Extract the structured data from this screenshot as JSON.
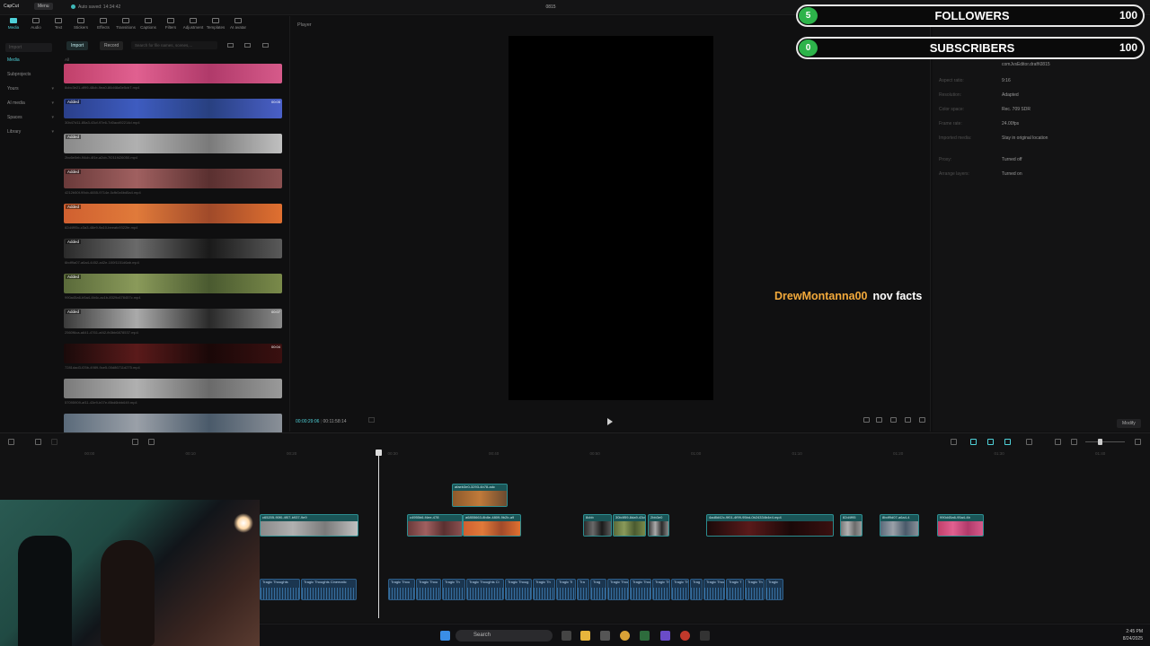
{
  "titlebar": {
    "logo": "CapCut",
    "menu": "Menu",
    "autosave": "Auto saved: 14:34:42",
    "project": "0815"
  },
  "tools": [
    "Media",
    "Audio",
    "Text",
    "Stickers",
    "Effects",
    "Transitions",
    "Captions",
    "Filters",
    "Adjustment",
    "Templates",
    "AI avatar"
  ],
  "leftnav": {
    "header": "Import",
    "items": [
      "Media",
      "Subprojects",
      "Yours",
      "AI media",
      "Spaces",
      "Library"
    ]
  },
  "media": {
    "import": "Import",
    "record": "Record",
    "search_placeholder": "Search for file names, scenes,...",
    "all_label": "All",
    "clips": [
      {
        "badge": "",
        "dur": "",
        "label": "8cbc3e21-df99-48cb-9ea0-86d48a5e5cb7.mp4"
      },
      {
        "badge": "Added",
        "dur": "00:05",
        "label": "30b47d11-85a3-43cf-97e6-7d0acd92214d.mp4"
      },
      {
        "badge": "Added",
        "dur": "",
        "label": "2bc6e0eb-94cb-4f1e-a2cb-7f211f426050.mp4"
      },
      {
        "badge": "Added",
        "dur": "",
        "label": "4212b50f-99cb-4655-9714e-0cfb0c6bd5a4.mp4"
      },
      {
        "badge": "Added",
        "dur": "",
        "label": "82d4f95c-c3a3-48e9-9a10-beeafc9322fe.mp4"
      },
      {
        "badge": "Added",
        "dur": "",
        "label": "6bdf9a07-a6a4-4452-a42e-100f1151d6ab.mp4"
      },
      {
        "badge": "Added",
        "dur": "",
        "label": "990a45a6-b5a4-4b4c-ac1b-8329c678457c.mp4"
      },
      {
        "badge": "Added",
        "dur": "00:07",
        "label": "2560f6ca-a641-4761-af42-fb3bb6878537.mp4"
      },
      {
        "badge": "",
        "dur": "00:04",
        "label": "7281dad3-f25b-4989-9ce5-00d86711d275.mp4"
      },
      {
        "badge": "",
        "dur": "",
        "label": "57095909-af11-43e9-b07e-f8bd6bbb649.mp4"
      },
      {
        "badge": "",
        "dur": "",
        "label": ""
      }
    ]
  },
  "player": {
    "title": "Player",
    "time_current": "00:00:29:06",
    "time_total": "00:11:58:14"
  },
  "details": {
    "tab": "Details",
    "rows": [
      {
        "k": "",
        "v": "comJvsEditor.draft\\0815"
      },
      {
        "k": "Aspect ratio:",
        "v": "9:16"
      },
      {
        "k": "Resolution:",
        "v": "Adapted"
      },
      {
        "k": "Color space:",
        "v": "Rec. 709 SDR"
      },
      {
        "k": "Frame rate:",
        "v": "24.00fps"
      },
      {
        "k": "Imported media:",
        "v": "Stay in original location"
      },
      {
        "k": "Proxy:",
        "v": "Turned off"
      },
      {
        "k": "Arrange layers:",
        "v": "Turned on"
      }
    ],
    "modify": "Modify"
  },
  "overlay": {
    "followers": {
      "count": "5",
      "label": "FOLLOWERS",
      "goal": "100"
    },
    "subscribers": {
      "count": "0",
      "label": "SUBSCRIBERS",
      "goal": "100"
    },
    "chat": {
      "user": "DrewMontanna00",
      "message": "nov facts"
    }
  },
  "timeline": {
    "ruler": [
      "00:00",
      "00:10",
      "00:20",
      "00:30",
      "00:40",
      "00:50",
      "01:00",
      "01:10",
      "01:20",
      "01:30",
      "01:40"
    ],
    "overlay_clip": "afaeb3e0-3293-4b78-adc",
    "video_clips": [
      "c65205-90f0-4f07-b937-9e9",
      "c4955b6-f4ee-478",
      "a6855663-8b8e-4809-9b2b-a9",
      "8cbb",
      "30b4f59-8da9-43cf-9",
      "2bb3e0",
      "4ad8d42c-9f01-4f99-95bd-0b24334b4e4.mp4",
      "82d4f95",
      "8bdf9d07-a6a4-4",
      "990d45a6-95a4-4b"
    ],
    "audio_clips": [
      "Tragic Thoughts",
      "Tragic Thoughts Cinematic",
      "Tragic Thou",
      "Tragic Thou",
      "Tragic Th",
      "Tragic Thoughts Ci",
      "Tragic Thoug",
      "Tragic Th",
      "Tragic Ti",
      "Tra",
      "Trag",
      "Tragic Thou",
      "Tragic Thou",
      "Tragic Th",
      "Tragic Th",
      "Trag",
      "Tragic Thoug",
      "Tragic T",
      "Tragic Th",
      "Tragic"
    ]
  },
  "taskbar": {
    "search": "Search",
    "time": "2:45 PM",
    "date": "8/24/2025"
  }
}
